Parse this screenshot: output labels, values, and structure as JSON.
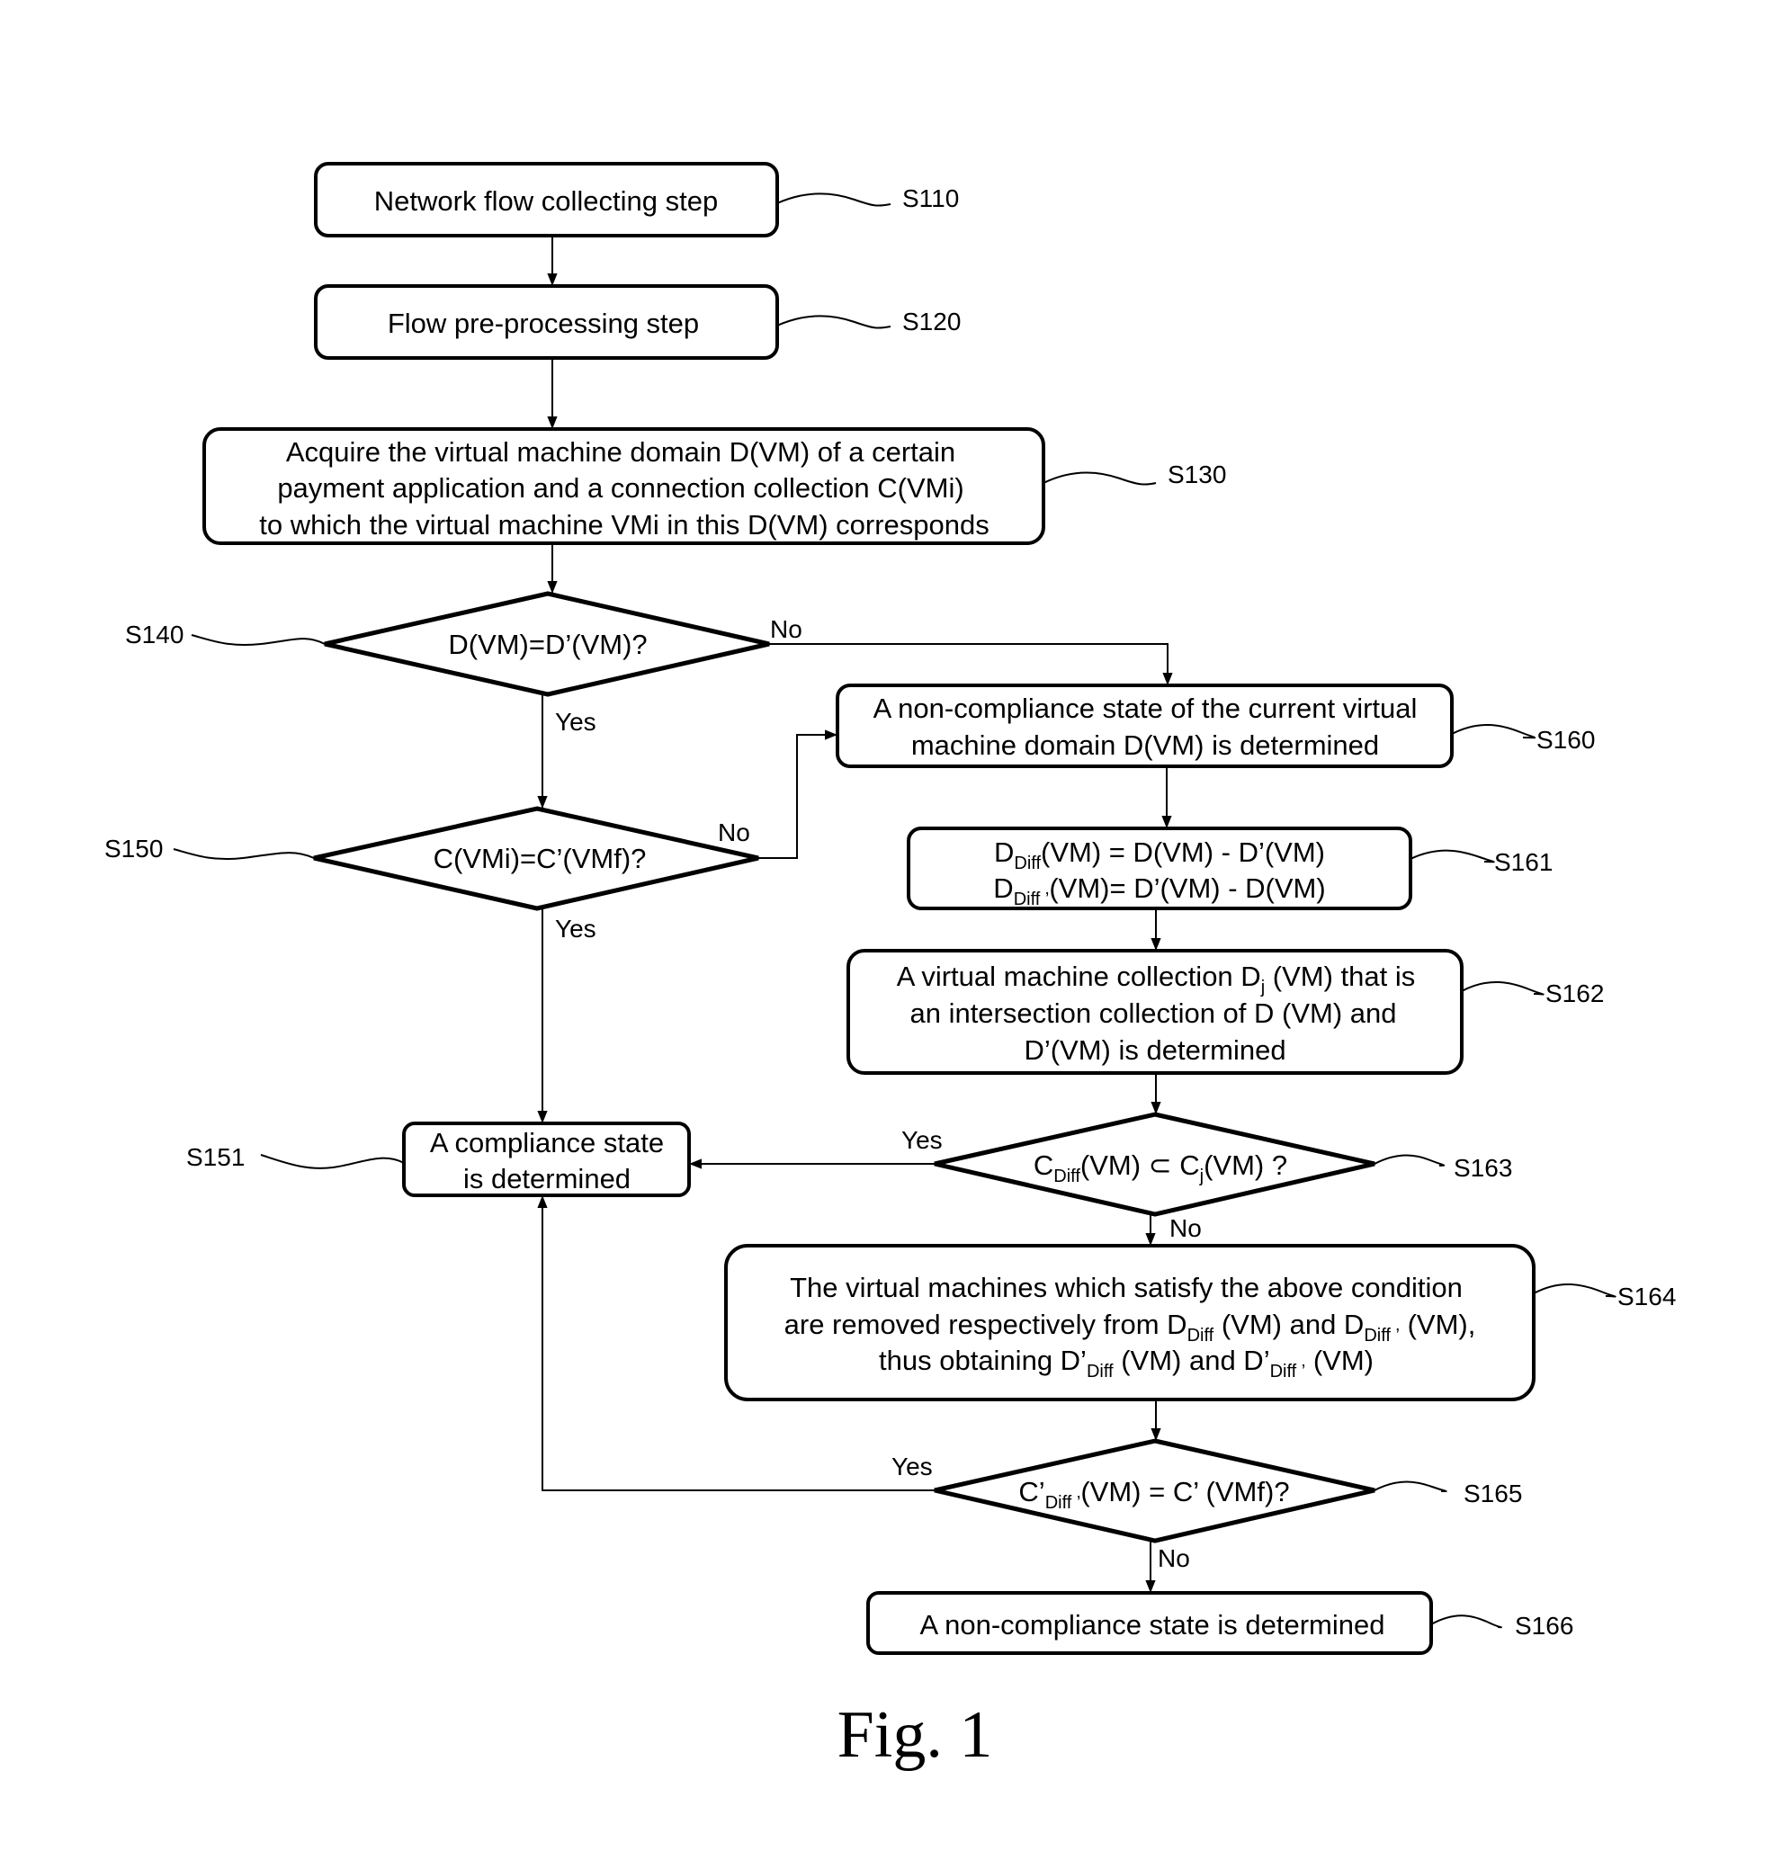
{
  "figure": {
    "caption": "Fig. 1",
    "colors": {
      "stroke": "#000000",
      "background": "#ffffff"
    }
  },
  "steps": {
    "s110": {
      "id": "S110",
      "text": "Network flow collecting step"
    },
    "s120": {
      "id": "S120",
      "text": "Flow pre-processing step"
    },
    "s130": {
      "id": "S130",
      "lines": [
        "Acquire the virtual machine domain D(VM) of a certain",
        "payment application and a connection collection C(VMi)",
        "to which the virtual machine VMi in this D(VM) corresponds"
      ]
    },
    "s140": {
      "id": "S140",
      "text": "D(VM)=D’(VM)?"
    },
    "s150": {
      "id": "S150",
      "text": "C(VMi)=C’(VMf)?"
    },
    "s151": {
      "id": "S151",
      "lines": [
        "A compliance state",
        "is determined"
      ]
    },
    "s160": {
      "id": "S160",
      "lines": [
        "A non-compliance state of the current virtual",
        "machine domain D(VM) is determined"
      ]
    },
    "s161": {
      "id": "S161",
      "line1": {
        "a": "D",
        "sub": "Diff",
        "b": "(VM) = D(VM) - D’(VM)"
      },
      "line2": {
        "a": "D",
        "sub": "Diff ’",
        "b": "(VM)= D’(VM) - D(VM)"
      }
    },
    "s162": {
      "id": "S162",
      "line1": {
        "a": "A virtual machine collection D",
        "sub": "j",
        "b": " (VM) that is"
      },
      "line2": "an intersection collection of D (VM) and",
      "line3": "D’(VM) is determined"
    },
    "s163": {
      "id": "S163",
      "a": "C",
      "sub1": "Diff",
      "b": "(VM) ⊂ C",
      "sub2": "j",
      "c": "(VM) ?"
    },
    "s164": {
      "id": "S164",
      "line1": "The virtual machines which satisfy the above condition",
      "line2": {
        "a": "are removed respectively from D",
        "sub1": "Diff",
        "b": " (VM) and D",
        "sub2": "Diff ’",
        "c": " (VM),"
      },
      "line3": {
        "a": "thus obtaining D’",
        "sub1": "Diff",
        "b": " (VM) and D’",
        "sub2": "Diff ’",
        "c": " (VM)"
      }
    },
    "s165": {
      "id": "S165",
      "a": "C’",
      "sub": "Diff ’",
      "b": "(VM) = C’ (VMf)?"
    },
    "s166": {
      "id": "S166",
      "text": "A non-compliance state is determined"
    }
  },
  "branch_labels": {
    "s140_no": "No",
    "s140_yes": "Yes",
    "s150_no": "No",
    "s150_yes": "Yes",
    "s163_yes": "Yes",
    "s163_no": "No",
    "s165_yes": "Yes",
    "s165_no": "No"
  }
}
